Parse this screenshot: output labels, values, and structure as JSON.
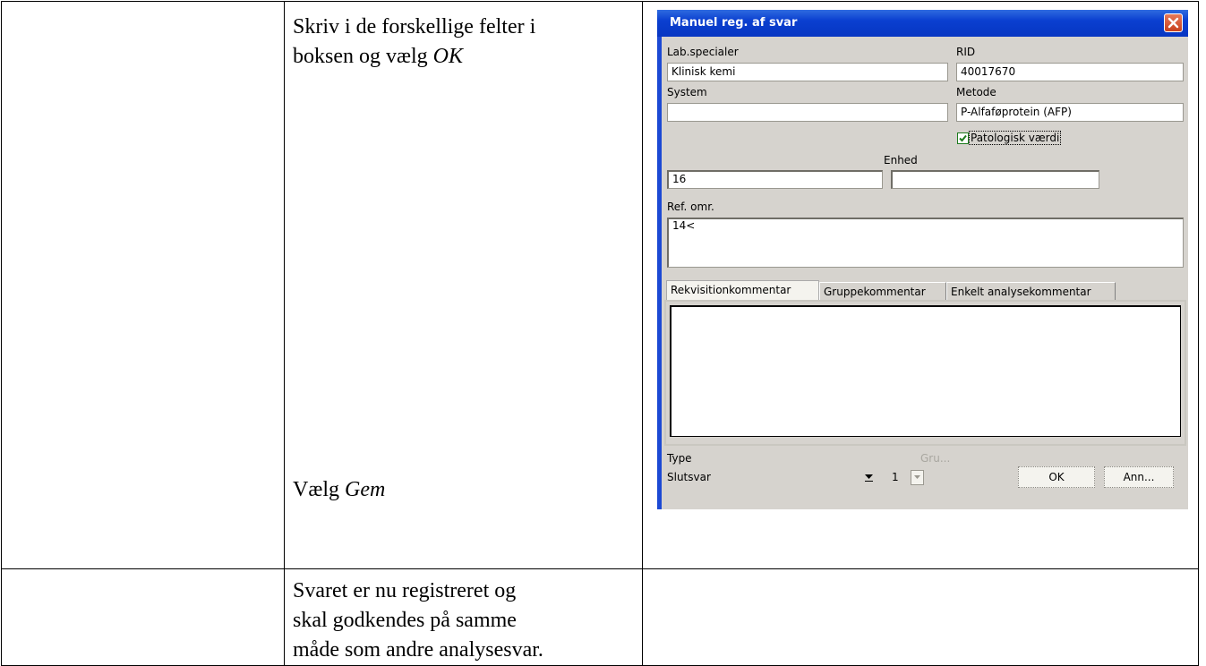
{
  "document": {
    "row1_text1": "Skriv i de forskellige felter i",
    "row1_text2_prefix": "boksen og vælg ",
    "row1_text2_em": "OK",
    "row1_text3_prefix": "Vælg ",
    "row1_text3_em": "Gem",
    "row2_line1": "Svaret er nu registreret og",
    "row2_line2": "skal godkendes på samme",
    "row2_line3": "måde som andre analysesvar."
  },
  "dialog": {
    "title": "Manuel reg. af svar",
    "lab_label": "Lab.specialer",
    "lab_value": "Klinisk kemi",
    "rid_label": "RID",
    "rid_value": "40017670",
    "system_label": "System",
    "system_value": "",
    "metode_label": "Metode",
    "metode_value": "P-Alfaføprotein (AFP)",
    "patologisk_label": "Patologisk værdi",
    "patologisk_checked": true,
    "value_field": "16",
    "enhed_label": "Enhed",
    "enhed_value": "",
    "ref_label": "Ref. omr.",
    "ref_value": "14<",
    "tabs": [
      "Rekvisitionkommentar",
      "Gruppekommentar",
      "Enkelt analysekommentar"
    ],
    "active_tab": 0,
    "type_label": "Type",
    "type_value": "Slutsvar",
    "gru_label": "Gru...",
    "gru_value": "1",
    "ok_label": "OK",
    "cancel_label": "Ann..."
  },
  "colors": {
    "titlebar": "#0a3fd0",
    "dialog_bg": "#d6d3ce",
    "close_red": "#c8401c",
    "checkbox_green": "#1d7a1d"
  }
}
